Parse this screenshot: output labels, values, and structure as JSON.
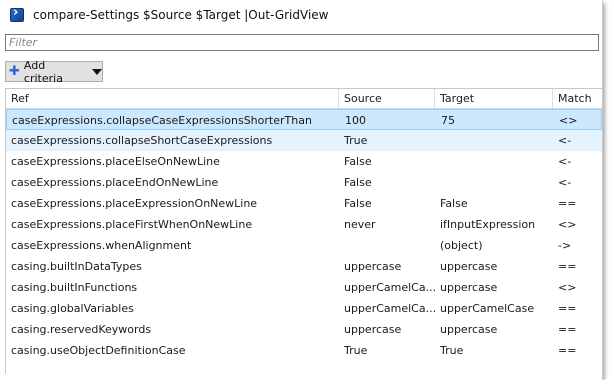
{
  "window": {
    "title": "compare-Settings  $Source $Target |Out-GridView"
  },
  "filter": {
    "placeholder": "Filter"
  },
  "toolbar": {
    "add_criteria_label": "Add criteria"
  },
  "grid": {
    "columns": [
      "Ref",
      "Source",
      "Target",
      "Match"
    ],
    "rows": [
      {
        "ref": "caseExpressions.collapseCaseExpressionsShorterThan",
        "source": "100",
        "target": "75",
        "match": "<>"
      },
      {
        "ref": "caseExpressions.collapseShortCaseExpressions",
        "source": "True",
        "target": "",
        "match": "<-"
      },
      {
        "ref": "caseExpressions.placeElseOnNewLine",
        "source": "False",
        "target": "",
        "match": "<-"
      },
      {
        "ref": "caseExpressions.placeEndOnNewLine",
        "source": "False",
        "target": "",
        "match": "<-"
      },
      {
        "ref": "caseExpressions.placeExpressionOnNewLine",
        "source": "False",
        "target": "False",
        "match": "=="
      },
      {
        "ref": "caseExpressions.placeFirstWhenOnNewLine",
        "source": "never",
        "target": "ifInputExpression",
        "match": "<>"
      },
      {
        "ref": "caseExpressions.whenAlignment",
        "source": "",
        "target": "(object)",
        "match": "->"
      },
      {
        "ref": "casing.builtInDataTypes",
        "source": "uppercase",
        "target": "uppercase",
        "match": "=="
      },
      {
        "ref": "casing.builtInFunctions",
        "source": "upperCamelCa...",
        "target": "uppercase",
        "match": "<>"
      },
      {
        "ref": "casing.globalVariables",
        "source": "upperCamelCa...",
        "target": "upperCamelCase",
        "match": "=="
      },
      {
        "ref": "casing.reservedKeywords",
        "source": "uppercase",
        "target": "uppercase",
        "match": "=="
      },
      {
        "ref": "casing.useObjectDefinitionCase",
        "source": "True",
        "target": "True",
        "match": "=="
      }
    ]
  },
  "colors": {
    "selected_row": "#cce8ff",
    "hover_row": "#e5f3ff",
    "accent": "#2e6ad1"
  }
}
